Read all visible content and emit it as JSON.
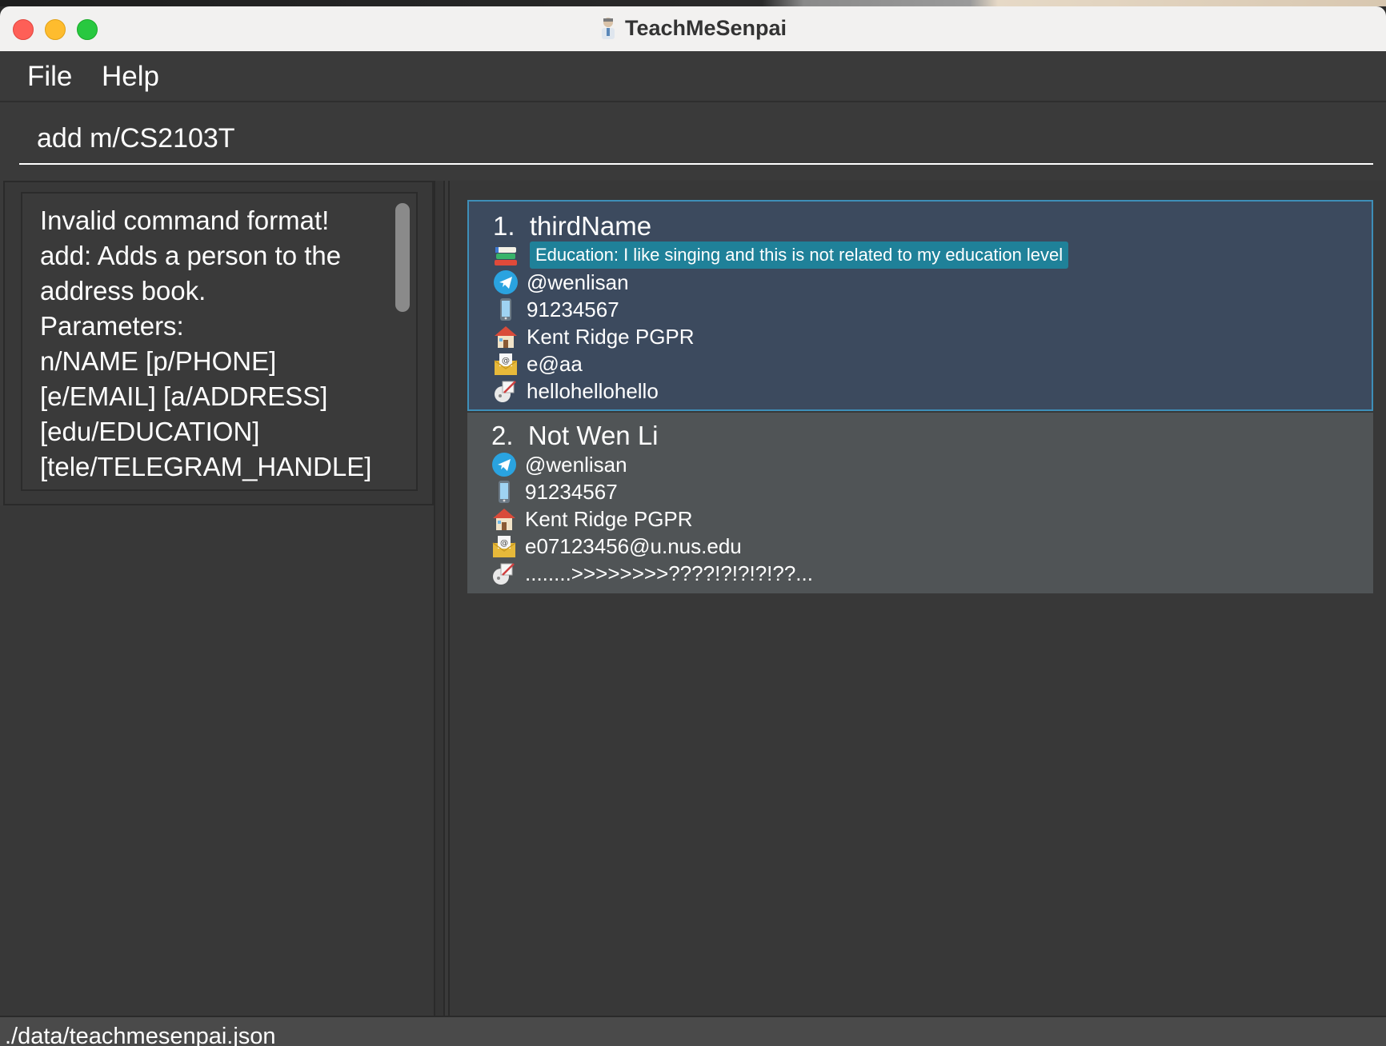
{
  "window": {
    "title": "TeachMeSenpai"
  },
  "menu": {
    "file": "File",
    "help": "Help"
  },
  "command": {
    "value": "add m/CS2103T"
  },
  "result": {
    "text": "Invalid command format!\nadd: Adds a person to the address book.\nParameters:\nn/NAME [p/PHONE]\n[e/EMAIL] [a/ADDRESS]\n[edu/EDUCATION]\n[tele/TELEGRAM_HANDLE]"
  },
  "persons": [
    {
      "index": "1.",
      "name": "thirdName",
      "education": "Education: I like singing and this is not related to my education level",
      "telegram": "@wenlisan",
      "phone": "91234567",
      "address": "Kent Ridge PGPR",
      "email": "e@aa",
      "remark": "hellohellohello"
    },
    {
      "index": "2.",
      "name": "Not Wen Li",
      "telegram": "@wenlisan",
      "phone": "91234567",
      "address": "Kent Ridge PGPR",
      "email": "e07123456@u.nus.edu",
      "remark": "........>>>>>>>>????!?!?!?!??..."
    }
  ],
  "status": {
    "path": "./data/teachmesenpai.json"
  },
  "colors": {
    "selected_card": "#3c4a5e",
    "selected_border": "#3e8fb8",
    "normal_card": "#505456",
    "education_tag": "#1f8199",
    "background": "#383838"
  },
  "icons": {
    "education": "books-icon",
    "telegram": "telegram-icon",
    "phone": "phone-icon",
    "address": "house-icon",
    "email": "email-icon",
    "remark": "remark-icon"
  }
}
